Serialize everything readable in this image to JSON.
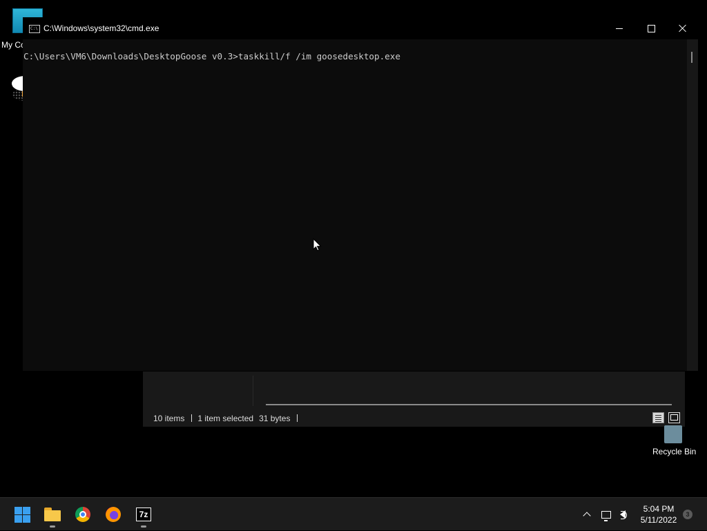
{
  "desktop": {
    "icons": {
      "my_computer_label": "My Co",
      "recycle_bin_label": "Recycle Bin"
    }
  },
  "explorer": {
    "status_items": "10 items",
    "status_selected": "1 item selected",
    "status_size": "31 bytes"
  },
  "cmd": {
    "title": "C:\\Windows\\system32\\cmd.exe",
    "icon_text": "C:\\",
    "line1": "C:\\Users\\VM6\\Downloads\\DesktopGoose v0.3>taskkill/f /im goosedesktop.exe"
  },
  "taskbar": {
    "apps": [
      "start-icon",
      "file-explorer-icon",
      "chrome-icon",
      "firefox-icon",
      "7zip-icon"
    ],
    "seven_zip_label": "7z",
    "clock_time": "5:04 PM",
    "clock_date": "5/11/2022",
    "notification_count": "3"
  }
}
